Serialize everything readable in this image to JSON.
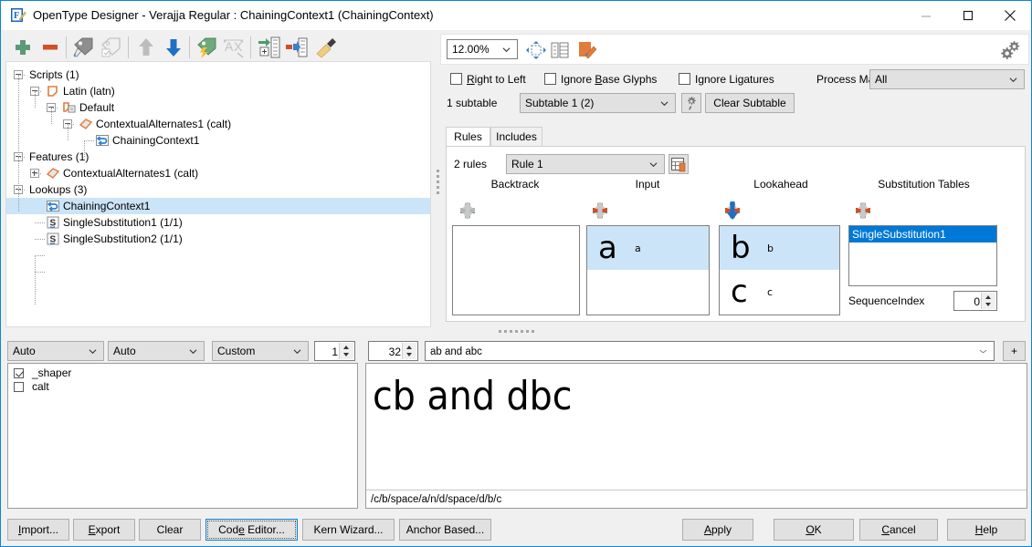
{
  "window": {
    "title": "OpenType Designer - Verajja Regular : ChainingContext1 (ChainingContext)",
    "app_icon": "opentype-designer-icon",
    "minimize": "—",
    "maximize": "□",
    "close": "✕"
  },
  "toolbar": {
    "items": [
      {
        "name": "add-icon",
        "tip": "Add"
      },
      {
        "name": "remove-icon",
        "tip": "Remove"
      },
      {
        "name": "edit-tag-icon",
        "tip": "Edit Tag"
      },
      {
        "name": "check-tag-icon",
        "tip": "Check Tag"
      },
      {
        "name": "move-up-icon",
        "tip": "Move Up"
      },
      {
        "name": "move-down-icon",
        "tip": "Move Down"
      },
      {
        "name": "quick-tag-icon",
        "tip": "Quick Tag"
      },
      {
        "name": "kern-ax-icon",
        "tip": "Kerning"
      },
      {
        "name": "import-table-icon",
        "tip": "Import Table"
      },
      {
        "name": "export-table-icon",
        "tip": "Export Table"
      },
      {
        "name": "cleanup-brush-icon",
        "tip": "Cleanup"
      }
    ]
  },
  "tree": {
    "nodes": [
      {
        "label": "Scripts (1)",
        "depth": 0,
        "icon": "none",
        "expander": "minus",
        "selected": false
      },
      {
        "label": "Latin (latn)",
        "depth": 1,
        "icon": "script-icon",
        "expander": "minus",
        "selected": false
      },
      {
        "label": "Default",
        "depth": 2,
        "icon": "language-icon",
        "expander": "minus",
        "selected": false
      },
      {
        "label": "ContextualAlternates1 (calt)",
        "depth": 3,
        "icon": "feature-icon",
        "expander": "minus",
        "selected": false
      },
      {
        "label": "ChainingContext1",
        "depth": 4,
        "icon": "chaining-icon",
        "expander": "none",
        "selected": false
      },
      {
        "label": "Features (1)",
        "depth": 0,
        "icon": "none",
        "expander": "minus",
        "selected": false
      },
      {
        "label": "ContextualAlternates1 (calt)",
        "depth": 1,
        "icon": "feature-icon",
        "expander": "plus",
        "selected": false
      },
      {
        "label": "Lookups (3)",
        "depth": 0,
        "icon": "none",
        "expander": "minus",
        "selected": false
      },
      {
        "label": "ChainingContext1",
        "depth": 1,
        "icon": "chaining-icon",
        "expander": "none",
        "selected": true
      },
      {
        "label": "SingleSubstitution1 (1/1)",
        "depth": 1,
        "icon": "single-sub-icon",
        "expander": "none",
        "selected": false
      },
      {
        "label": "SingleSubstitution2 (1/1)",
        "depth": 1,
        "icon": "single-sub-icon",
        "expander": "none",
        "selected": false
      }
    ]
  },
  "zoombar": {
    "zoom_value": "12.00%",
    "icons": [
      {
        "name": "fit-to-window-icon"
      },
      {
        "name": "glyph-grid-icon"
      },
      {
        "name": "edit-glyph-icon"
      }
    ],
    "settings_icon": "gears-icon"
  },
  "options": {
    "right_to_left": {
      "label": "Right to Left",
      "checked": false
    },
    "ignore_base_glyphs": {
      "label": "Ignore Base Glyphs",
      "checked": false
    },
    "ignore_ligatures": {
      "label": "Ignore Ligatures",
      "checked": false
    },
    "process_marks_label": "Process Marks:",
    "process_marks_value": "All"
  },
  "subtable": {
    "count_label": "1 subtable",
    "selected": "Subtable 1 (2)",
    "settings_icon": "subtable-settings-icon",
    "clear_label": "Clear Subtable"
  },
  "tabs": [
    {
      "label": "Rules",
      "active": true
    },
    {
      "label": "Includes",
      "active": false
    }
  ],
  "rules": {
    "count_label": "2 rules",
    "selected_rule": "Rule 1",
    "rule_table_icon": "rule-table-icon",
    "columns": [
      {
        "title": "Backtrack",
        "glyphs": [],
        "buttons": [
          {
            "name": "add-icon",
            "state": "enabled"
          },
          {
            "name": "remove-icon",
            "state": "disabled"
          },
          {
            "name": "up-icon",
            "state": "disabled"
          },
          {
            "name": "down-icon",
            "state": "disabled"
          }
        ]
      },
      {
        "title": "Input",
        "glyphs": [
          {
            "big": "a",
            "small": "a",
            "selected": true
          }
        ],
        "buttons": [
          {
            "name": "add-icon",
            "state": "enabled"
          },
          {
            "name": "remove-icon",
            "state": "enabled"
          },
          {
            "name": "up-icon",
            "state": "disabled"
          },
          {
            "name": "down-icon",
            "state": "disabled"
          }
        ]
      },
      {
        "title": "Lookahead",
        "glyphs": [
          {
            "big": "b",
            "small": "b",
            "selected": true
          },
          {
            "big": "c",
            "small": "c",
            "selected": false
          }
        ],
        "buttons": [
          {
            "name": "add-icon",
            "state": "enabled"
          },
          {
            "name": "remove-icon",
            "state": "enabled"
          },
          {
            "name": "up-icon",
            "state": "disabled"
          },
          {
            "name": "down-icon",
            "state": "active"
          }
        ]
      }
    ],
    "substitution_tables": {
      "title": "Substitution Tables",
      "items": [
        {
          "label": "SingleSubstitution1",
          "selected": true
        }
      ],
      "buttons": [
        {
          "name": "add-icon",
          "state": "enabled"
        },
        {
          "name": "remove-icon",
          "state": "enabled"
        },
        {
          "name": "up-icon",
          "state": "disabled"
        },
        {
          "name": "down-icon",
          "state": "disabled"
        }
      ],
      "sequence_index_label": "SequenceIndex",
      "sequence_index_value": "0"
    }
  },
  "preview_controls": {
    "dropdown1": "Auto",
    "dropdown2": "Auto",
    "dropdown3": "Custom",
    "spin1": "1",
    "spin2": "32",
    "sample_text": "ab and abc",
    "add_label": "+"
  },
  "features_list": [
    {
      "label": "_shaper",
      "checked": true
    },
    {
      "label": "calt",
      "checked": false
    }
  ],
  "preview": {
    "rendered_text": "cb and dbc",
    "status": "/c/b/space/a/n/d/space/d/b/c"
  },
  "bottom_buttons_left": [
    {
      "label": "Import...",
      "underline": 0,
      "focus": false
    },
    {
      "label": "Export",
      "underline": 0,
      "focus": false
    },
    {
      "label": "Clear",
      "underline": -1,
      "focus": false
    },
    {
      "label": "Code Editor...",
      "underline": 3,
      "focus": true
    },
    {
      "label": "Kern Wizard...",
      "underline": -1,
      "focus": false
    },
    {
      "label": "Anchor Based...",
      "underline": -1,
      "focus": false
    }
  ],
  "bottom_buttons_right": [
    {
      "label": "Apply",
      "underline": 0
    },
    {
      "label": "OK",
      "underline": 0
    },
    {
      "label": "Cancel",
      "underline": 0
    },
    {
      "label": "Help",
      "underline": 0
    }
  ],
  "colors": {
    "accent_blue": "#0a86d8",
    "selection_blue": "#cce4f7",
    "list_selection": "#0078d7",
    "green_add": "#5b9a78",
    "red_remove": "#d0502a",
    "orange": "#e08040",
    "window_bg": "#f0f0f0"
  }
}
